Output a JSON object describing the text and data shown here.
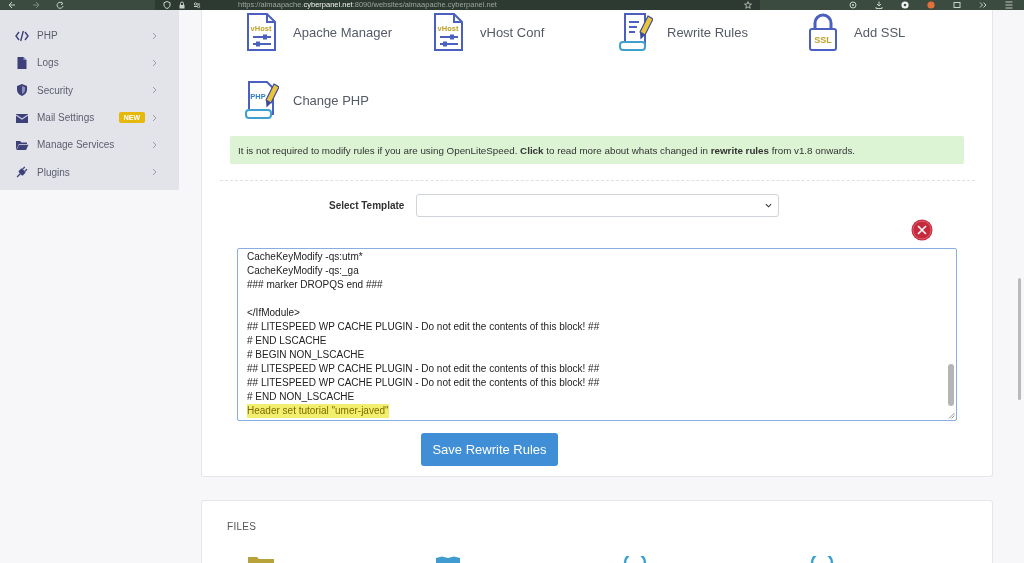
{
  "browser": {
    "url": {
      "scheme_and_subdomain": "https://almaapache.",
      "domain": "cyberpanel.net",
      "path": ":8090/websites/almaapache.cyberpanel.net"
    }
  },
  "sidebar": {
    "items": [
      {
        "label": "PHP"
      },
      {
        "label": "Logs"
      },
      {
        "label": "Security"
      },
      {
        "label": "Mail Settings",
        "badge": "NEW"
      },
      {
        "label": "Manage Services"
      },
      {
        "label": "Plugins"
      }
    ]
  },
  "website_actions": [
    {
      "label": "Apache Manager",
      "icon_text": "vHost"
    },
    {
      "label": "vHost Conf",
      "icon_text": "vHost"
    },
    {
      "label": "Rewrite Rules"
    },
    {
      "label": "Add SSL",
      "icon_text": "SSL"
    },
    {
      "label": "Change PHP",
      "icon_text": "PHP"
    }
  ],
  "notice": {
    "text": "It is not required to modify rules if you are using OpenLiteSpeed. **Click** to read more about whats changed in **rewrite rules** from v1.8 onwards."
  },
  "template_select": {
    "label": "Select Template"
  },
  "rewrite_rules": {
    "blocks": [
      {
        "lines": [
          {
            "text": "CacheKeyModify -qs:utm*",
            "highlighted": false
          },
          {
            "text": "CacheKeyModify -qs:_ga",
            "highlighted": false
          },
          {
            "text": "### marker DROPQS end ###",
            "highlighted": false
          }
        ]
      },
      {
        "lines": [
          {
            "text": "</IfModule>",
            "highlighted": false
          },
          {
            "text": "## LITESPEED WP CACHE PLUGIN - Do not edit the contents of this block! ##",
            "highlighted": false
          },
          {
            "text": "# END LSCACHE",
            "highlighted": false
          },
          {
            "text": "# BEGIN NON_LSCACHE",
            "highlighted": false
          },
          {
            "text": "## LITESPEED WP CACHE PLUGIN - Do not edit the contents of this block! ##",
            "highlighted": false
          },
          {
            "text": "## LITESPEED WP CACHE PLUGIN - Do not edit the contents of this block! ##",
            "highlighted": false
          },
          {
            "text": "# END NON_LSCACHE",
            "highlighted": false
          },
          {
            "text": "Header set tutorial \"umer-javed\"",
            "highlighted": true
          }
        ]
      }
    ]
  },
  "save_button": {
    "label": "Save Rewrite Rules"
  },
  "files_section": {
    "title": "FILES"
  }
}
